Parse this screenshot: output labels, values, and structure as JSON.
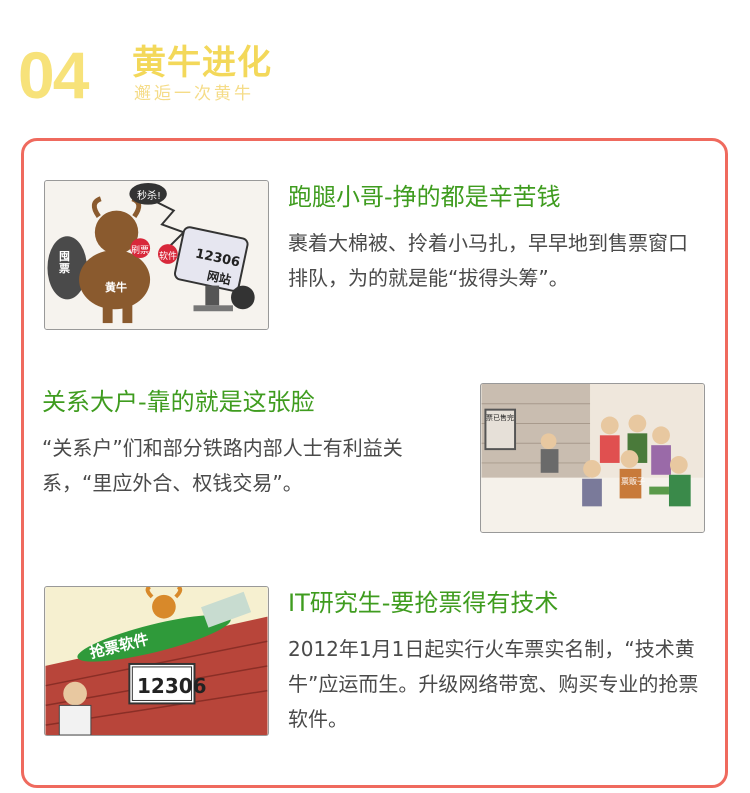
{
  "header": {
    "number": "04",
    "title": "黄牛进化",
    "subtitle": "邂逅一次黄牛"
  },
  "sections": [
    {
      "title": "跑腿小哥-挣的都是辛苦钱",
      "body": "裹着大棉被、拎着小马扎，早早地到售票窗口排队，为的就是能“拔得头筹”。",
      "image_labels": [
        "秒杀!",
        "囤票",
        "刷票",
        "软件",
        "黄牛",
        "12306",
        "网站"
      ]
    },
    {
      "title": "关系大户-靠的就是这张脸",
      "body": "“关系户”们和部分铁路内部人士有利益关系，“里应外合、权钱交易”。",
      "image_labels": [
        "票已售完",
        "票贩子"
      ]
    },
    {
      "title": "IT研究生-要抢票得有技术",
      "body": "2012年1月1日起实行火车票实名制，“技术黄牛”应运而生。升级网络带宽、购买专业的抢票软件。",
      "image_labels": [
        "抢票软件",
        "12306"
      ]
    }
  ],
  "colors": {
    "accent_title": "#3f9c1f",
    "frame": "#ef6a5e",
    "header_yellow": "#f3d85a"
  }
}
